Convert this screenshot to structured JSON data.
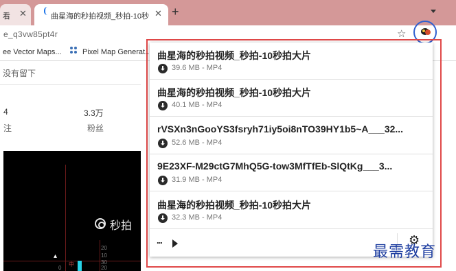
{
  "browser": {
    "tabs": [
      {
        "label": "看",
        "state": "inactive"
      },
      {
        "label": "曲星海的秒拍视频_秒拍-10秒",
        "state": "active"
      }
    ],
    "new_tab_label": "+",
    "address_bar": {
      "url_text": "e_q3vw85pt4r"
    },
    "bookmarks": [
      "ee Vector Maps...",
      "Pixel Map Generat..."
    ],
    "icons": [
      "close-icon",
      "loading-favicon",
      "plus-icon",
      "chevron-down-icon",
      "star-icon",
      "extension-icon",
      "pixel-map-favicon"
    ],
    "highlight_color": "#2f5fd0"
  },
  "page": {
    "top_text": "没有留下",
    "stats": [
      {
        "value": "4",
        "label": "注"
      },
      {
        "value": "3.3万",
        "label": "粉丝"
      }
    ],
    "video": {
      "watermark": "秒拍",
      "labels": [
        "20",
        "10",
        "中",
        "0",
        "30",
        "20"
      ]
    }
  },
  "popup": {
    "highlight_color": "#e04848",
    "items": [
      {
        "title": "曲星海的秒拍视频_秒拍-10秒拍大片",
        "size": "39.6 MB",
        "format": "MP4"
      },
      {
        "title": "曲星海的秒拍视频_秒拍-10秒拍大片",
        "size": "40.1 MB",
        "format": "MP4"
      },
      {
        "title": "rVSXn3nGooYS3fsryh71iy5oi8nTO39HY1b5~A___32...",
        "size": "52.6 MB",
        "format": "MP4"
      },
      {
        "title": "9E23XF-M29ctG7MhQ5G-tow3MfTfEb-SlQtKg___3...",
        "size": "31.9 MB",
        "format": "MP4"
      },
      {
        "title": "曲星海的秒拍视频_秒拍-10秒拍大片",
        "size": "32.3 MB",
        "format": "MP4"
      }
    ],
    "meta_separator": " - ",
    "more_label": "...",
    "icons": [
      "download-icon",
      "play-icon",
      "gear-icon"
    ]
  },
  "watermark_brand": "最需教育"
}
